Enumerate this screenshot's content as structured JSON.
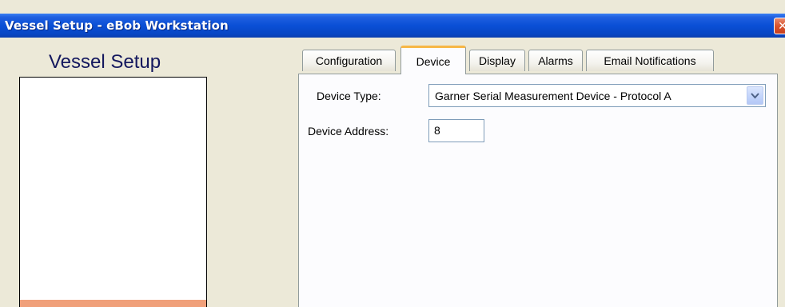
{
  "window": {
    "title": "Vessel Setup - eBob Workstation",
    "close_glyph": "✕"
  },
  "left": {
    "heading": "Vessel Setup"
  },
  "tabs": [
    {
      "label": "Configuration",
      "active": false
    },
    {
      "label": "Device",
      "active": true
    },
    {
      "label": "Display",
      "active": false
    },
    {
      "label": "Alarms",
      "active": false
    },
    {
      "label": "Email Notifications",
      "active": false
    }
  ],
  "device": {
    "type_label": "Device Type:",
    "type_value": "Garner Serial Measurement Device - Protocol A",
    "address_label": "Device Address:",
    "address_value": "8"
  },
  "icons": {
    "dropdown_arrow": "chevron-down-icon",
    "close": "close-icon"
  },
  "colors": {
    "titlebar": "#0a4fd6",
    "heading": "#14185e",
    "active_tab_accent": "#f7b746",
    "selected_list_item": "#f0a07a"
  }
}
